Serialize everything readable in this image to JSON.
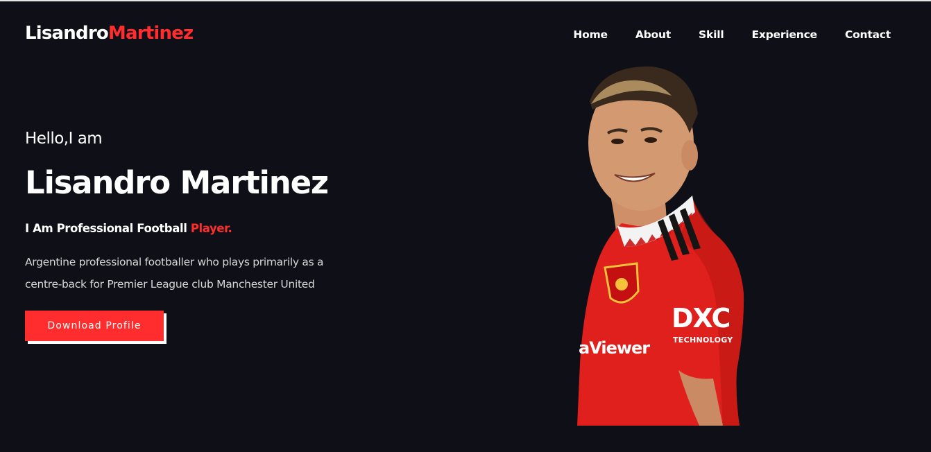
{
  "logo": {
    "first": "Lisandro",
    "last": "Martinez"
  },
  "nav": {
    "items": [
      {
        "label": "Home"
      },
      {
        "label": "About"
      },
      {
        "label": "Skill"
      },
      {
        "label": "Experience"
      },
      {
        "label": "Contact"
      }
    ]
  },
  "hero": {
    "greeting": "Hello,I am",
    "name": "Lisandro Martinez",
    "subtitle_prefix": "I Am Professional Football ",
    "subtitle_accent": "Player.",
    "description": "Argentine professional footballer who plays primarily as a centre-back for Premier League club Manchester United",
    "button_label": "Download Profile"
  },
  "jersey": {
    "sponsor": "aViewer",
    "sleeve_logo": "DXC",
    "sleeve_text": "TECHNOLOGY"
  },
  "colors": {
    "background": "#0f1017",
    "accent": "#ff2d2d",
    "text": "#ffffff",
    "muted_text": "#d6d6d6"
  }
}
